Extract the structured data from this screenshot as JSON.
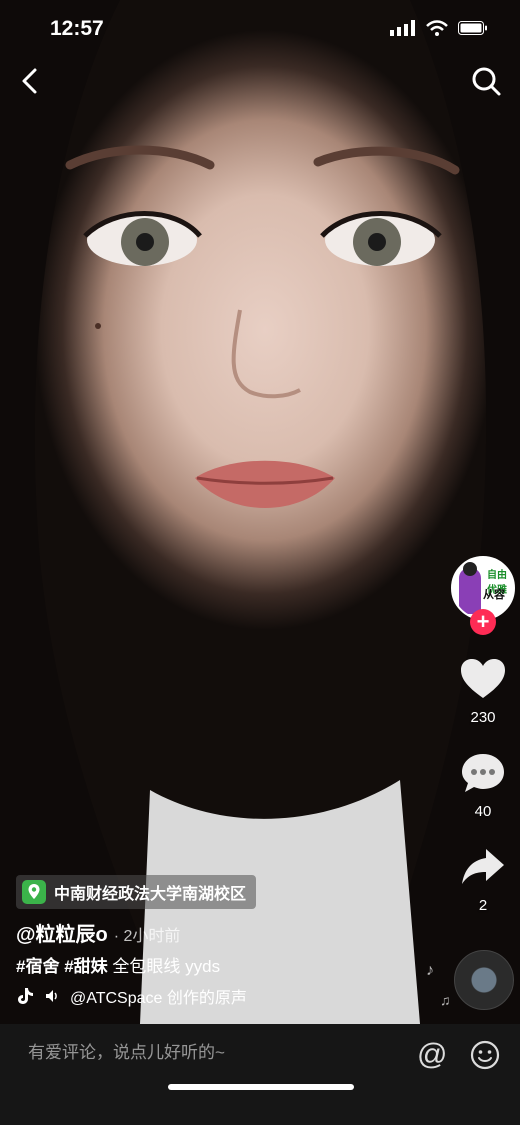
{
  "status_bar": {
    "time": "12:57"
  },
  "location": {
    "name": "中南财经政法大学南湖校区"
  },
  "author": {
    "handle": "@粒粒辰o",
    "time_ago": "· 2小时前"
  },
  "caption": {
    "tag1": "#宿舍",
    "tag2": "#甜妹",
    "text": "全包眼线 yyds"
  },
  "music": {
    "label": "@ATCSpace 创作的原声"
  },
  "avatar": {
    "text_top": "自由 优雅",
    "text_mid": "从容"
  },
  "actions": {
    "likes": "230",
    "comments": "40",
    "shares": "2"
  },
  "comment_bar": {
    "placeholder": "有爱评论，说点儿好听的~"
  },
  "colors": {
    "accent": "#fe2c55",
    "comment_bar": "#161616"
  }
}
